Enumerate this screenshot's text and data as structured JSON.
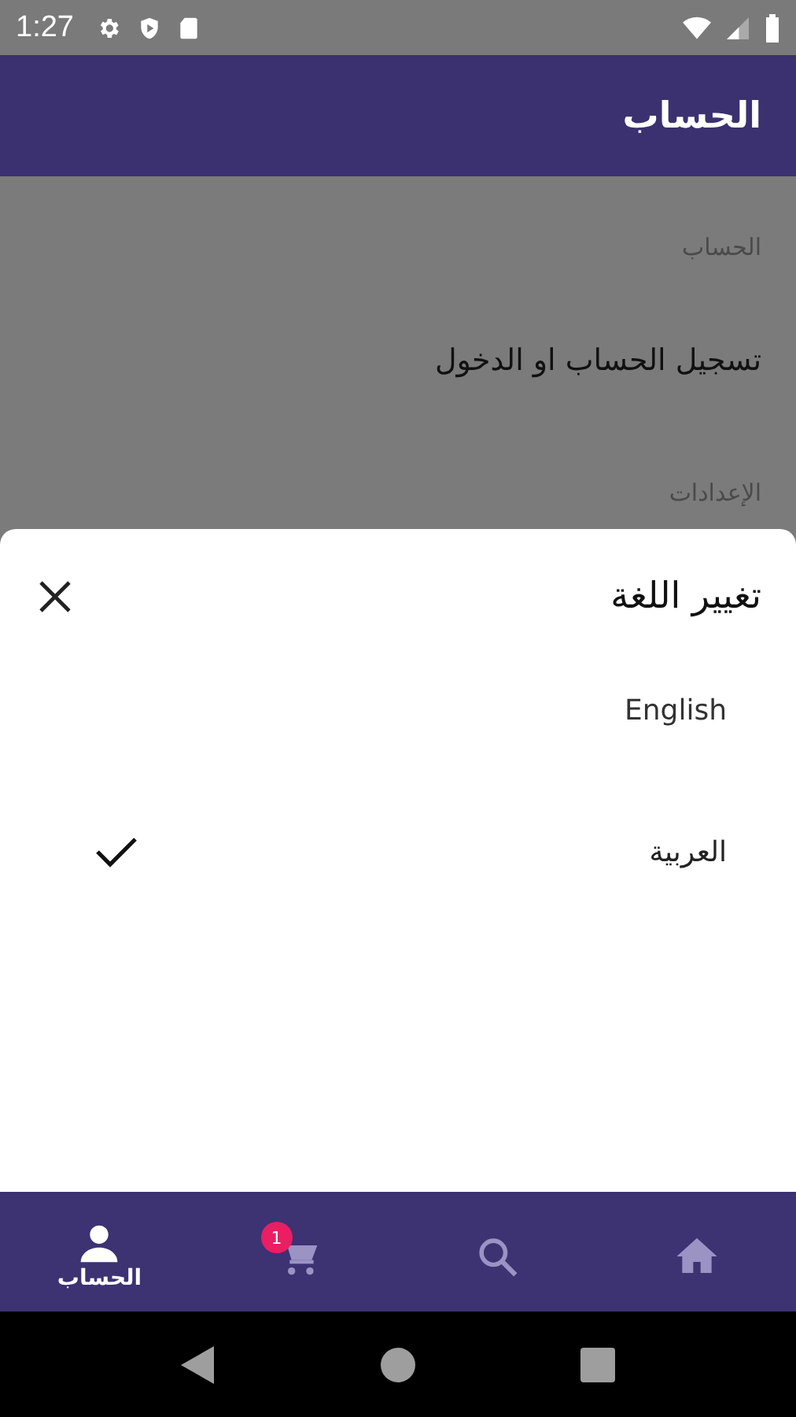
{
  "status_bar": {
    "time": "1:27"
  },
  "app_bar": {
    "title": "الحساب"
  },
  "content": [
    {
      "kind": "header",
      "text": "الحساب"
    },
    {
      "kind": "row",
      "text": "تسجيل الحساب او الدخول"
    },
    {
      "kind": "header",
      "text": "الإعدادات"
    }
  ],
  "sheet": {
    "title": "تغيير اللغة",
    "options": [
      {
        "label": "English",
        "selected": false
      },
      {
        "label": "العربية",
        "selected": true
      }
    ]
  },
  "bottom_nav": [
    {
      "kind": "account",
      "label": "الحساب",
      "selected": true
    },
    {
      "kind": "cart",
      "badge": "1",
      "selected": false
    },
    {
      "kind": "search",
      "selected": false
    },
    {
      "kind": "home",
      "selected": false
    }
  ]
}
